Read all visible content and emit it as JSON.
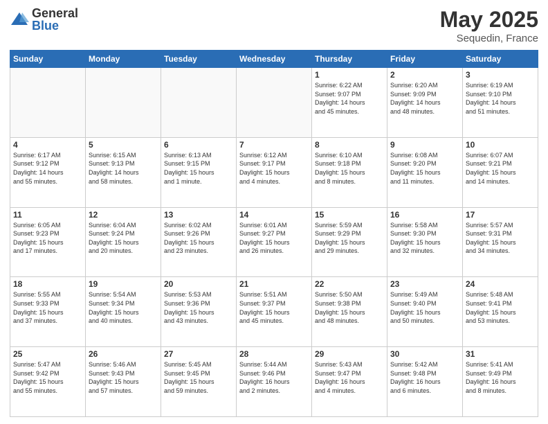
{
  "logo": {
    "general": "General",
    "blue": "Blue"
  },
  "title": {
    "month_year": "May 2025",
    "location": "Sequedin, France"
  },
  "weekdays": [
    "Sunday",
    "Monday",
    "Tuesday",
    "Wednesday",
    "Thursday",
    "Friday",
    "Saturday"
  ],
  "weeks": [
    [
      {
        "day": "",
        "info": ""
      },
      {
        "day": "",
        "info": ""
      },
      {
        "day": "",
        "info": ""
      },
      {
        "day": "",
        "info": ""
      },
      {
        "day": "1",
        "info": "Sunrise: 6:22 AM\nSunset: 9:07 PM\nDaylight: 14 hours\nand 45 minutes."
      },
      {
        "day": "2",
        "info": "Sunrise: 6:20 AM\nSunset: 9:09 PM\nDaylight: 14 hours\nand 48 minutes."
      },
      {
        "day": "3",
        "info": "Sunrise: 6:19 AM\nSunset: 9:10 PM\nDaylight: 14 hours\nand 51 minutes."
      }
    ],
    [
      {
        "day": "4",
        "info": "Sunrise: 6:17 AM\nSunset: 9:12 PM\nDaylight: 14 hours\nand 55 minutes."
      },
      {
        "day": "5",
        "info": "Sunrise: 6:15 AM\nSunset: 9:13 PM\nDaylight: 14 hours\nand 58 minutes."
      },
      {
        "day": "6",
        "info": "Sunrise: 6:13 AM\nSunset: 9:15 PM\nDaylight: 15 hours\nand 1 minute."
      },
      {
        "day": "7",
        "info": "Sunrise: 6:12 AM\nSunset: 9:17 PM\nDaylight: 15 hours\nand 4 minutes."
      },
      {
        "day": "8",
        "info": "Sunrise: 6:10 AM\nSunset: 9:18 PM\nDaylight: 15 hours\nand 8 minutes."
      },
      {
        "day": "9",
        "info": "Sunrise: 6:08 AM\nSunset: 9:20 PM\nDaylight: 15 hours\nand 11 minutes."
      },
      {
        "day": "10",
        "info": "Sunrise: 6:07 AM\nSunset: 9:21 PM\nDaylight: 15 hours\nand 14 minutes."
      }
    ],
    [
      {
        "day": "11",
        "info": "Sunrise: 6:05 AM\nSunset: 9:23 PM\nDaylight: 15 hours\nand 17 minutes."
      },
      {
        "day": "12",
        "info": "Sunrise: 6:04 AM\nSunset: 9:24 PM\nDaylight: 15 hours\nand 20 minutes."
      },
      {
        "day": "13",
        "info": "Sunrise: 6:02 AM\nSunset: 9:26 PM\nDaylight: 15 hours\nand 23 minutes."
      },
      {
        "day": "14",
        "info": "Sunrise: 6:01 AM\nSunset: 9:27 PM\nDaylight: 15 hours\nand 26 minutes."
      },
      {
        "day": "15",
        "info": "Sunrise: 5:59 AM\nSunset: 9:29 PM\nDaylight: 15 hours\nand 29 minutes."
      },
      {
        "day": "16",
        "info": "Sunrise: 5:58 AM\nSunset: 9:30 PM\nDaylight: 15 hours\nand 32 minutes."
      },
      {
        "day": "17",
        "info": "Sunrise: 5:57 AM\nSunset: 9:31 PM\nDaylight: 15 hours\nand 34 minutes."
      }
    ],
    [
      {
        "day": "18",
        "info": "Sunrise: 5:55 AM\nSunset: 9:33 PM\nDaylight: 15 hours\nand 37 minutes."
      },
      {
        "day": "19",
        "info": "Sunrise: 5:54 AM\nSunset: 9:34 PM\nDaylight: 15 hours\nand 40 minutes."
      },
      {
        "day": "20",
        "info": "Sunrise: 5:53 AM\nSunset: 9:36 PM\nDaylight: 15 hours\nand 43 minutes."
      },
      {
        "day": "21",
        "info": "Sunrise: 5:51 AM\nSunset: 9:37 PM\nDaylight: 15 hours\nand 45 minutes."
      },
      {
        "day": "22",
        "info": "Sunrise: 5:50 AM\nSunset: 9:38 PM\nDaylight: 15 hours\nand 48 minutes."
      },
      {
        "day": "23",
        "info": "Sunrise: 5:49 AM\nSunset: 9:40 PM\nDaylight: 15 hours\nand 50 minutes."
      },
      {
        "day": "24",
        "info": "Sunrise: 5:48 AM\nSunset: 9:41 PM\nDaylight: 15 hours\nand 53 minutes."
      }
    ],
    [
      {
        "day": "25",
        "info": "Sunrise: 5:47 AM\nSunset: 9:42 PM\nDaylight: 15 hours\nand 55 minutes."
      },
      {
        "day": "26",
        "info": "Sunrise: 5:46 AM\nSunset: 9:43 PM\nDaylight: 15 hours\nand 57 minutes."
      },
      {
        "day": "27",
        "info": "Sunrise: 5:45 AM\nSunset: 9:45 PM\nDaylight: 15 hours\nand 59 minutes."
      },
      {
        "day": "28",
        "info": "Sunrise: 5:44 AM\nSunset: 9:46 PM\nDaylight: 16 hours\nand 2 minutes."
      },
      {
        "day": "29",
        "info": "Sunrise: 5:43 AM\nSunset: 9:47 PM\nDaylight: 16 hours\nand 4 minutes."
      },
      {
        "day": "30",
        "info": "Sunrise: 5:42 AM\nSunset: 9:48 PM\nDaylight: 16 hours\nand 6 minutes."
      },
      {
        "day": "31",
        "info": "Sunrise: 5:41 AM\nSunset: 9:49 PM\nDaylight: 16 hours\nand 8 minutes."
      }
    ]
  ]
}
